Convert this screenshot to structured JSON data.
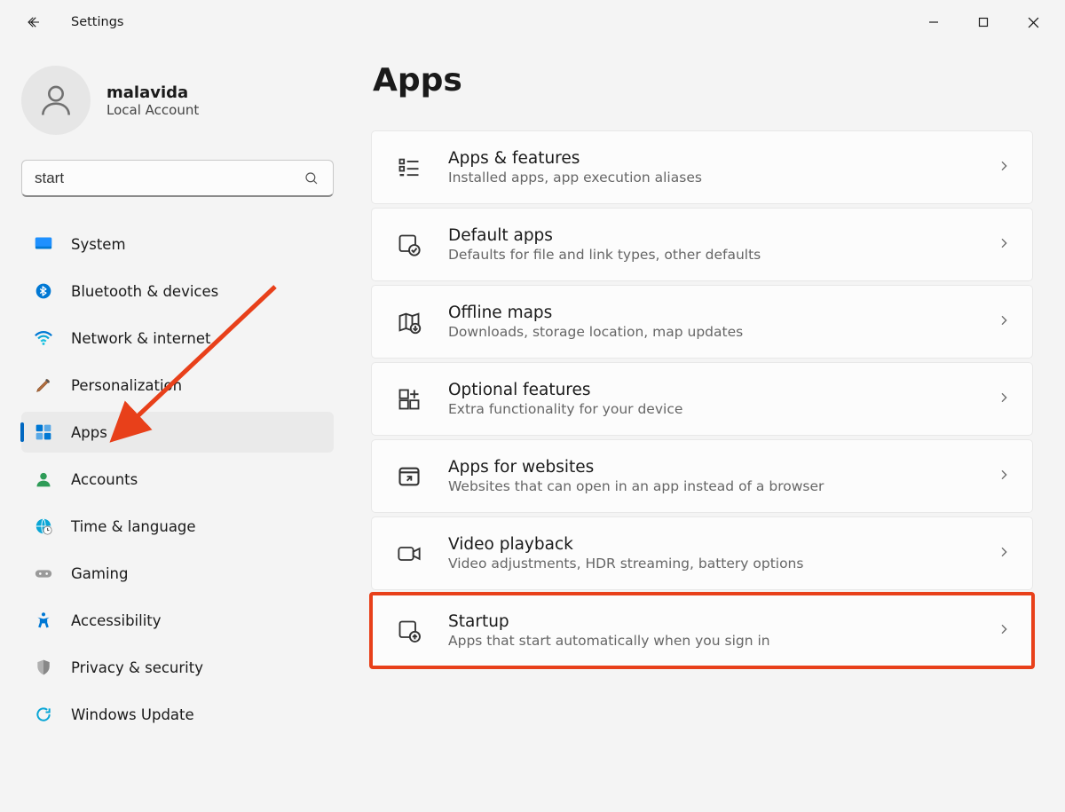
{
  "titlebar": {
    "app_name": "Settings"
  },
  "profile": {
    "name": "malavida",
    "sub": "Local Account"
  },
  "search": {
    "value": "start"
  },
  "sidebar": {
    "items": [
      {
        "label": "System"
      },
      {
        "label": "Bluetooth & devices"
      },
      {
        "label": "Network & internet"
      },
      {
        "label": "Personalization"
      },
      {
        "label": "Apps"
      },
      {
        "label": "Accounts"
      },
      {
        "label": "Time & language"
      },
      {
        "label": "Gaming"
      },
      {
        "label": "Accessibility"
      },
      {
        "label": "Privacy & security"
      },
      {
        "label": "Windows Update"
      }
    ]
  },
  "main": {
    "title": "Apps",
    "cards": [
      {
        "title": "Apps & features",
        "sub": "Installed apps, app execution aliases"
      },
      {
        "title": "Default apps",
        "sub": "Defaults for file and link types, other defaults"
      },
      {
        "title": "Offline maps",
        "sub": "Downloads, storage location, map updates"
      },
      {
        "title": "Optional features",
        "sub": "Extra functionality for your device"
      },
      {
        "title": "Apps for websites",
        "sub": "Websites that can open in an app instead of a browser"
      },
      {
        "title": "Video playback",
        "sub": "Video adjustments, HDR streaming, battery options"
      },
      {
        "title": "Startup",
        "sub": "Apps that start automatically when you sign in"
      }
    ]
  },
  "annotation": {
    "highlight_card_index": 6,
    "arrow_color": "#e8401a"
  }
}
